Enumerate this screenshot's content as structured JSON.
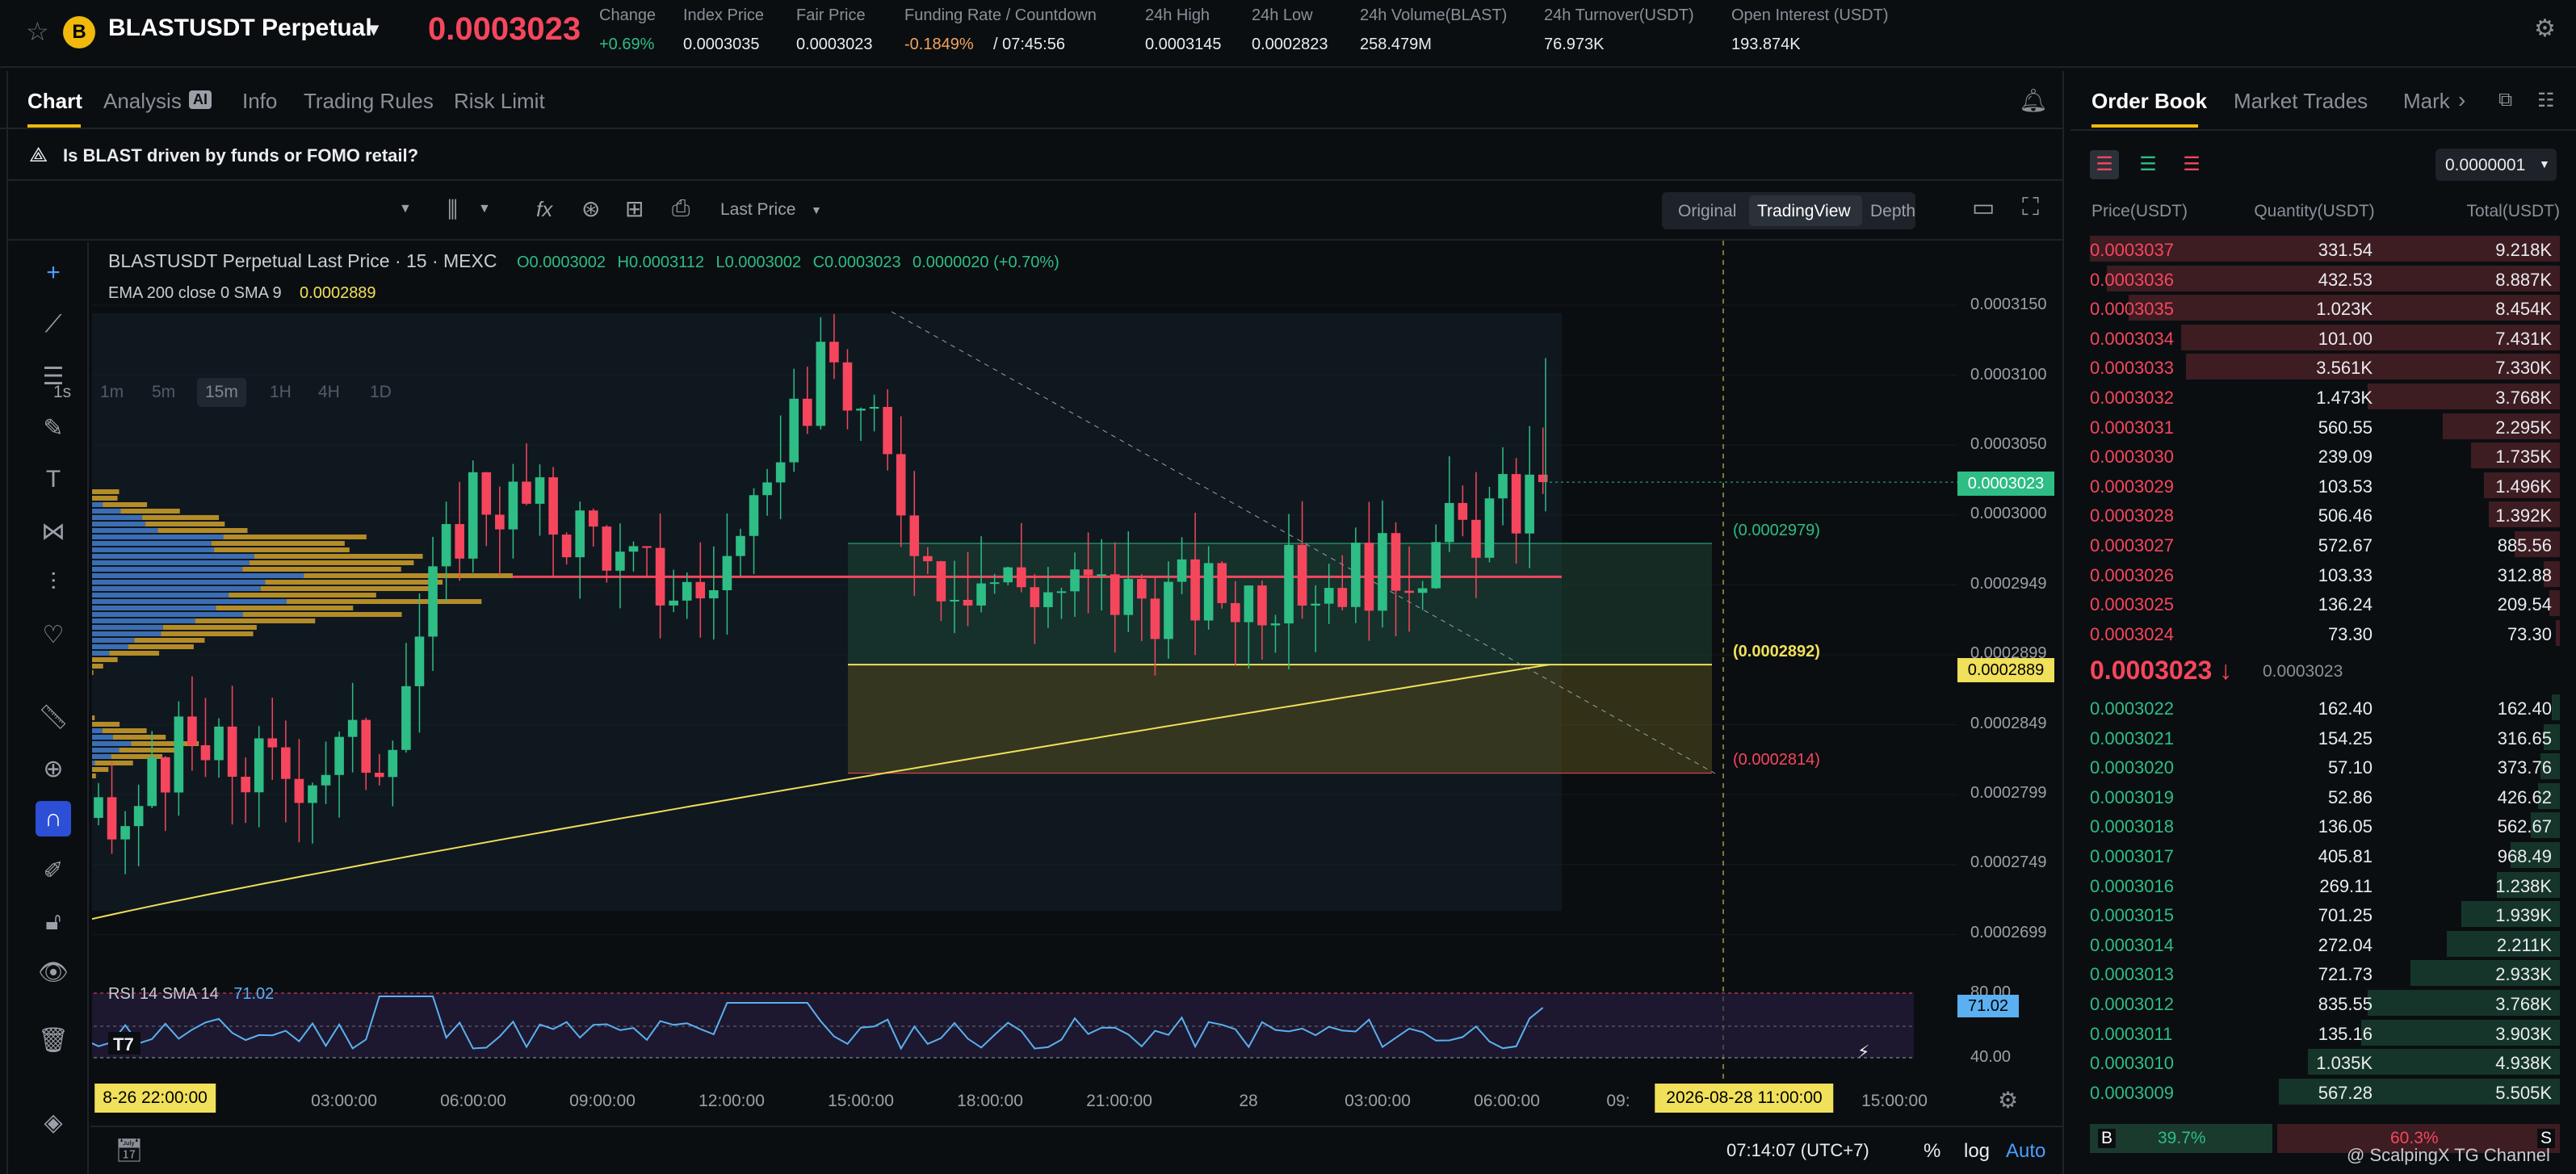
{
  "header": {
    "symbol": "BLASTUSDT Perpetual",
    "last_price": "0.0003023",
    "stats": [
      {
        "label": "Change",
        "value": "+0.69%",
        "color": "#2ebd85"
      },
      {
        "label": "Index Price",
        "value": "0.0003035"
      },
      {
        "label": "Fair Price",
        "value": "0.0003023"
      },
      {
        "label": "Funding Rate / Countdown",
        "value": "-0.1849%",
        "value2": "/ 07:45:56",
        "color": "#f0a35e"
      },
      {
        "label": "24h High",
        "value": "0.0003145"
      },
      {
        "label": "24h Low",
        "value": "0.0002823"
      },
      {
        "label": "24h Volume(BLAST)",
        "value": "258.479M"
      },
      {
        "label": "24h Turnover(USDT)",
        "value": "76.973K"
      },
      {
        "label": "Open Interest (USDT)",
        "value": "193.874K"
      }
    ]
  },
  "chart_tabs": {
    "chart": "Chart",
    "analysis": "Analysis",
    "ai_badge": "AI",
    "info": "Info",
    "rules": "Trading Rules",
    "risk": "Risk Limit"
  },
  "banner": "Is BLAST driven by funds or FOMO retail?",
  "intervals": [
    "1s",
    "1m",
    "5m",
    "15m",
    "1H",
    "4H",
    "1D"
  ],
  "active_interval": "15m",
  "price_type": "Last Price",
  "views": [
    "Original",
    "TradingView",
    "Depth"
  ],
  "legend": {
    "title": "BLASTUSDT Perpetual Last Price · 15 · MEXC",
    "o": "O0.0003002",
    "h": "H0.0003112",
    "l": "L0.0003002",
    "c": "C0.0003023",
    "chg": "0.0000020 (+0.70%)",
    "ema": "EMA 200 close 0 SMA 9",
    "ema_val": "0.0002889"
  },
  "rsi": {
    "label": "RSI 14 SMA 14",
    "value": "71.02",
    "scale": [
      "80.00",
      "40.00"
    ]
  },
  "y_ticks": [
    "0.0003150",
    "0.0003100",
    "0.0003050",
    "0.0003000",
    "0.0002949",
    "0.0002899",
    "0.0002849",
    "0.0002799",
    "0.0002749",
    "0.0002699"
  ],
  "price_tags": {
    "last": "0.0003023",
    "ema": "0.0002889"
  },
  "zone_labels": [
    "(0.0002979)",
    "(0.0002892)",
    "(0.0002814)"
  ],
  "x_ticks": [
    "8-26  22:00:00",
    "03:00:00",
    "06:00:00",
    "09:00:00",
    "12:00:00",
    "15:00:00",
    "18:00:00",
    "21:00:00",
    "28",
    "03:00:00",
    "06:00:00",
    "09:",
    "2026-08-28   11:00:00",
    "15:00:00"
  ],
  "footer": {
    "clock": "07:14:07 (UTC+7)",
    "pct": "%",
    "log": "log",
    "auto": "Auto"
  },
  "orderbook": {
    "tabs": [
      "Order Book",
      "Market Trades",
      "Mark"
    ],
    "precision": "0.0000001",
    "headers": [
      "Price(USDT)",
      "Quantity(USDT)",
      "Total(USDT)"
    ],
    "asks": [
      [
        "0.0003037",
        "331.54",
        "9.218K"
      ],
      [
        "0.0003036",
        "432.53",
        "8.887K"
      ],
      [
        "0.0003035",
        "1.023K",
        "8.454K"
      ],
      [
        "0.0003034",
        "101.00",
        "7.431K"
      ],
      [
        "0.0003033",
        "3.561K",
        "7.330K"
      ],
      [
        "0.0003032",
        "1.473K",
        "3.768K"
      ],
      [
        "0.0003031",
        "560.55",
        "2.295K"
      ],
      [
        "0.0003030",
        "239.09",
        "1.735K"
      ],
      [
        "0.0003029",
        "103.53",
        "1.496K"
      ],
      [
        "0.0003028",
        "506.46",
        "1.392K"
      ],
      [
        "0.0003027",
        "572.67",
        "885.56"
      ],
      [
        "0.0003026",
        "103.33",
        "312.88"
      ],
      [
        "0.0003025",
        "136.24",
        "209.54"
      ],
      [
        "0.0003024",
        "73.30",
        "73.30"
      ]
    ],
    "mid_price": "0.0003023 ↓",
    "mid_mark": "0.0003023",
    "bids": [
      [
        "0.0003022",
        "162.40",
        "162.40"
      ],
      [
        "0.0003021",
        "154.25",
        "316.65"
      ],
      [
        "0.0003020",
        "57.10",
        "373.76"
      ],
      [
        "0.0003019",
        "52.86",
        "426.62"
      ],
      [
        "0.0003018",
        "136.05",
        "562.67"
      ],
      [
        "0.0003017",
        "405.81",
        "968.49"
      ],
      [
        "0.0003016",
        "269.11",
        "1.238K"
      ],
      [
        "0.0003015",
        "701.25",
        "1.939K"
      ],
      [
        "0.0003014",
        "272.04",
        "2.211K"
      ],
      [
        "0.0003013",
        "721.73",
        "2.933K"
      ],
      [
        "0.0003012",
        "835.55",
        "3.768K"
      ],
      [
        "0.0003011",
        "135.16",
        "3.903K"
      ],
      [
        "0.0003010",
        "1.035K",
        "4.938K"
      ],
      [
        "0.0003009",
        "567.28",
        "5.505K"
      ]
    ],
    "buy_label": "B",
    "buy_pct": "39.7%",
    "sell_pct": "60.3%",
    "sell_label": "S",
    "watermark": "@ ScalpingX TG Channel"
  },
  "colors": {
    "up": "#2ebd85",
    "down": "#f6465d",
    "bg": "#0b0e11",
    "panel": "#161a1e",
    "accent": "#f0b90b",
    "ema": "#f0e05a",
    "rsi": "#5ab0f0"
  }
}
